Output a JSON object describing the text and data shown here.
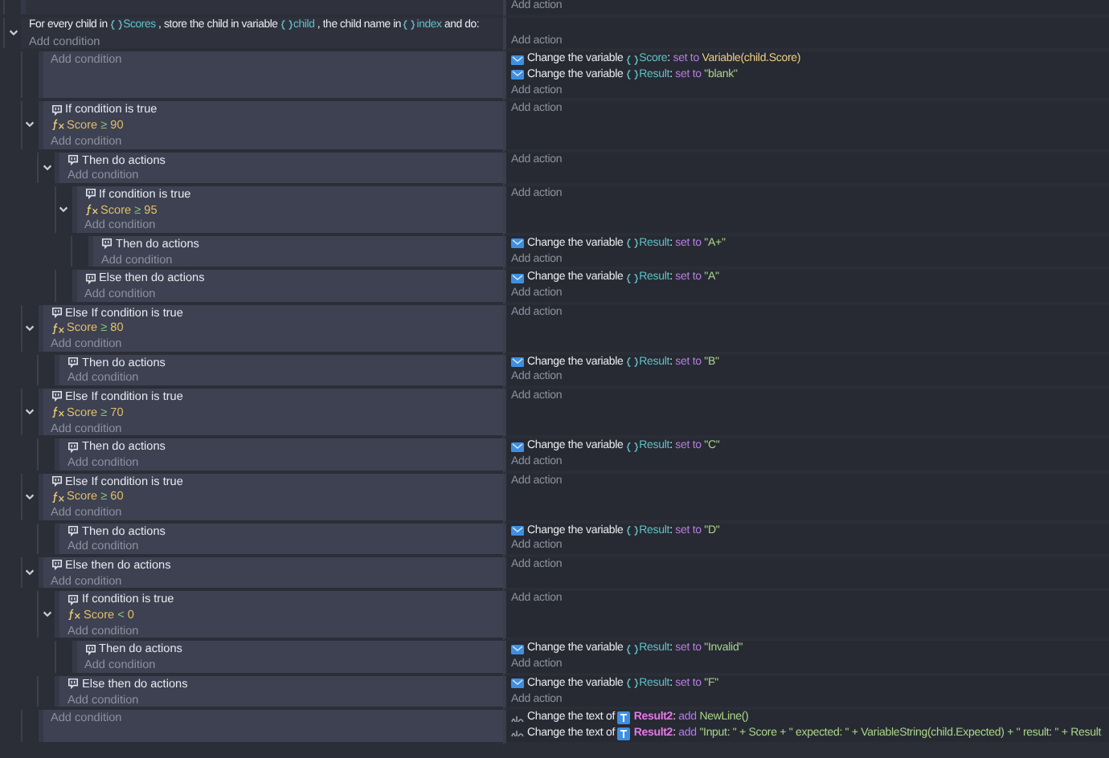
{
  "events": [
    {
      "kind": "standard",
      "add_action": "Add action"
    },
    {
      "kind": "foreach",
      "expanded": true,
      "header": [
        {
          "kind": "text",
          "text": "For every child in "
        },
        {
          "kind": "variable",
          "text": "Scores"
        },
        {
          "kind": "text",
          "text": " , store the child in variable "
        },
        {
          "kind": "variable",
          "text": "child"
        },
        {
          "kind": "text",
          "text": " , the child name in "
        },
        {
          "kind": "variable",
          "text": "index"
        },
        {
          "kind": "text",
          "text": " and do:"
        }
      ],
      "add_condition": "Add condition",
      "add_action": "Add action",
      "children": [
        {
          "kind": "standard",
          "add_condition": "Add condition",
          "actions": [
            {
              "kind": "variable",
              "parts": [
                {
                  "kind": "text",
                  "text": "Change the variable "
                },
                {
                  "kind": "variable",
                  "text": "Score"
                },
                {
                  "kind": "text",
                  "text": ": "
                },
                {
                  "kind": "keyword",
                  "text": "set to "
                },
                {
                  "kind": "expression",
                  "text": "Variable(child.Score)"
                }
              ]
            },
            {
              "kind": "variable",
              "parts": [
                {
                  "kind": "text",
                  "text": "Change the variable "
                },
                {
                  "kind": "variable",
                  "text": "Result"
                },
                {
                  "kind": "text",
                  "text": ": "
                },
                {
                  "kind": "keyword",
                  "text": "set to "
                },
                {
                  "kind": "string",
                  "text": "\"blank\""
                }
              ]
            }
          ],
          "add_action": "Add action"
        },
        {
          "kind": "branch",
          "title": "If condition is true",
          "expanded": true,
          "conditions": [
            {
              "subject": "Score",
              "operator": "≥",
              "value": "90"
            }
          ],
          "add_condition": "Add condition",
          "add_action": "Add action",
          "children": [
            {
              "kind": "branch",
              "title": "Then do actions",
              "expanded": true,
              "add_condition": "Add condition",
              "add_action": "Add action",
              "children": [
                {
                  "kind": "branch",
                  "title": "If condition is true",
                  "expanded": true,
                  "conditions": [
                    {
                      "subject": "Score",
                      "operator": "≥",
                      "value": "95"
                    }
                  ],
                  "add_condition": "Add condition",
                  "add_action": "Add action",
                  "children": [
                    {
                      "kind": "branch",
                      "title": "Then do actions",
                      "add_condition": "Add condition",
                      "actions": [
                        {
                          "kind": "variable",
                          "parts": [
                            {
                              "kind": "text",
                              "text": "Change the variable "
                            },
                            {
                              "kind": "variable",
                              "text": "Result"
                            },
                            {
                              "kind": "text",
                              "text": ": "
                            },
                            {
                              "kind": "keyword",
                              "text": "set to "
                            },
                            {
                              "kind": "string",
                              "text": "\"A+\""
                            }
                          ]
                        }
                      ],
                      "add_action": "Add action"
                    }
                  ]
                },
                {
                  "kind": "branch",
                  "title": "Else then do actions",
                  "add_condition": "Add condition",
                  "actions": [
                    {
                      "kind": "variable",
                      "parts": [
                        {
                          "kind": "text",
                          "text": "Change the variable "
                        },
                        {
                          "kind": "variable",
                          "text": "Result"
                        },
                        {
                          "kind": "text",
                          "text": ": "
                        },
                        {
                          "kind": "keyword",
                          "text": "set to "
                        },
                        {
                          "kind": "string",
                          "text": "\"A\""
                        }
                      ]
                    }
                  ],
                  "add_action": "Add action"
                }
              ]
            }
          ]
        },
        {
          "kind": "branch",
          "title": "Else If condition is true",
          "expanded": true,
          "conditions": [
            {
              "subject": "Score",
              "operator": "≥",
              "value": "80"
            }
          ],
          "add_condition": "Add condition",
          "add_action": "Add action",
          "children": [
            {
              "kind": "branch",
              "title": "Then do actions",
              "add_condition": "Add condition",
              "actions": [
                {
                  "kind": "variable",
                  "parts": [
                    {
                      "kind": "text",
                      "text": "Change the variable "
                    },
                    {
                      "kind": "variable",
                      "text": "Result"
                    },
                    {
                      "kind": "text",
                      "text": ": "
                    },
                    {
                      "kind": "keyword",
                      "text": "set to "
                    },
                    {
                      "kind": "string",
                      "text": "\"B\""
                    }
                  ]
                }
              ],
              "add_action": "Add action"
            }
          ]
        },
        {
          "kind": "branch",
          "title": "Else If condition is true",
          "expanded": true,
          "conditions": [
            {
              "subject": "Score",
              "operator": "≥",
              "value": "70"
            }
          ],
          "add_condition": "Add condition",
          "add_action": "Add action",
          "children": [
            {
              "kind": "branch",
              "title": "Then do actions",
              "add_condition": "Add condition",
              "actions": [
                {
                  "kind": "variable",
                  "parts": [
                    {
                      "kind": "text",
                      "text": "Change the variable "
                    },
                    {
                      "kind": "variable",
                      "text": "Result"
                    },
                    {
                      "kind": "text",
                      "text": ": "
                    },
                    {
                      "kind": "keyword",
                      "text": "set to "
                    },
                    {
                      "kind": "string",
                      "text": "\"C\""
                    }
                  ]
                }
              ],
              "add_action": "Add action"
            }
          ]
        },
        {
          "kind": "branch",
          "title": "Else If condition is true",
          "expanded": true,
          "conditions": [
            {
              "subject": "Score",
              "operator": "≥",
              "value": "60"
            }
          ],
          "add_condition": "Add condition",
          "add_action": "Add action",
          "children": [
            {
              "kind": "branch",
              "title": "Then do actions",
              "add_condition": "Add condition",
              "actions": [
                {
                  "kind": "variable",
                  "parts": [
                    {
                      "kind": "text",
                      "text": "Change the variable "
                    },
                    {
                      "kind": "variable",
                      "text": "Result"
                    },
                    {
                      "kind": "text",
                      "text": ": "
                    },
                    {
                      "kind": "keyword",
                      "text": "set to "
                    },
                    {
                      "kind": "string",
                      "text": "\"D\""
                    }
                  ]
                }
              ],
              "add_action": "Add action"
            }
          ]
        },
        {
          "kind": "branch",
          "title": "Else then do actions",
          "expanded": true,
          "add_condition": "Add condition",
          "add_action": "Add action",
          "children": [
            {
              "kind": "branch",
              "title": "If condition is true",
              "expanded": true,
              "conditions": [
                {
                  "subject": "Score",
                  "operator": "<",
                  "value": "0"
                }
              ],
              "add_condition": "Add condition",
              "add_action": "Add action",
              "children": [
                {
                  "kind": "branch",
                  "title": "Then do actions",
                  "add_condition": "Add condition",
                  "actions": [
                    {
                      "kind": "variable",
                      "parts": [
                        {
                          "kind": "text",
                          "text": "Change the variable "
                        },
                        {
                          "kind": "variable",
                          "text": "Result"
                        },
                        {
                          "kind": "text",
                          "text": ": "
                        },
                        {
                          "kind": "keyword",
                          "text": "set to "
                        },
                        {
                          "kind": "string",
                          "text": "\"Invalid\""
                        }
                      ]
                    }
                  ],
                  "add_action": "Add action"
                }
              ]
            },
            {
              "kind": "branch",
              "title": "Else then do actions",
              "add_condition": "Add condition",
              "actions": [
                {
                  "kind": "variable",
                  "parts": [
                    {
                      "kind": "text",
                      "text": "Change the variable "
                    },
                    {
                      "kind": "variable",
                      "text": "Result"
                    },
                    {
                      "kind": "text",
                      "text": ": "
                    },
                    {
                      "kind": "keyword",
                      "text": "set to "
                    },
                    {
                      "kind": "string",
                      "text": "\"F\""
                    }
                  ]
                }
              ],
              "add_action": "Add action"
            }
          ]
        },
        {
          "kind": "standard",
          "add_condition": "Add condition",
          "actions": [
            {
              "kind": "text",
              "parts": [
                {
                  "kind": "text",
                  "text": "Change the text of "
                },
                {
                  "kind": "object",
                  "text": "Result2"
                },
                {
                  "kind": "text",
                  "text": ": "
                },
                {
                  "kind": "keyword",
                  "text": "add "
                },
                {
                  "kind": "string",
                  "text": "NewLine()"
                }
              ]
            },
            {
              "kind": "text",
              "parts": [
                {
                  "kind": "text",
                  "text": "Change the text of "
                },
                {
                  "kind": "object",
                  "text": "Result2"
                },
                {
                  "kind": "text",
                  "text": ": "
                },
                {
                  "kind": "keyword",
                  "text": "add "
                },
                {
                  "kind": "string",
                  "text": "\"Input: \" + Score + \" expected: \" + VariableString(child.Expected) + \" result: \" + Result"
                }
              ]
            }
          ]
        }
      ]
    }
  ]
}
